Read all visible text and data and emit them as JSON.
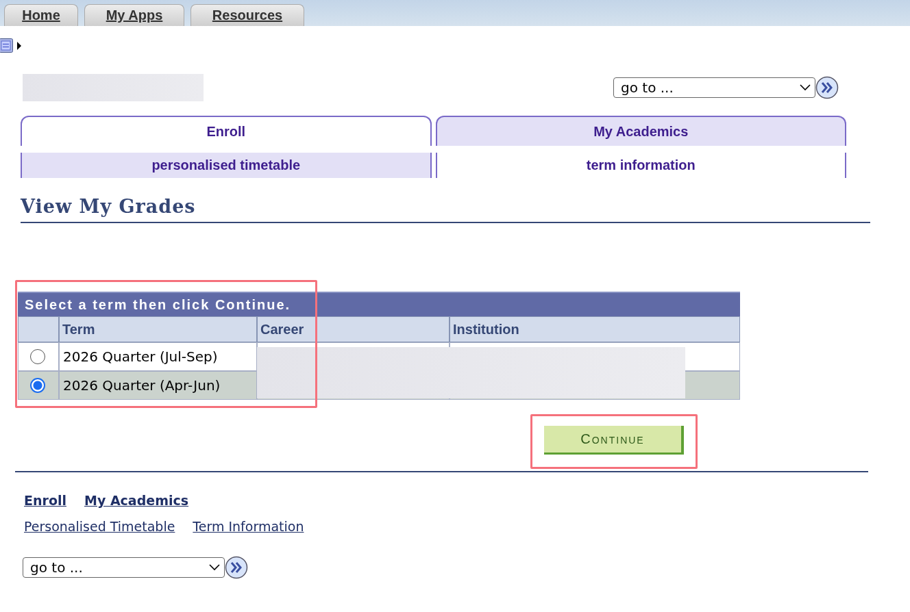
{
  "top_tabs": [
    {
      "label": "Home"
    },
    {
      "label": "My Apps"
    },
    {
      "label": "Resources"
    }
  ],
  "goto_top": {
    "value": "go to ..."
  },
  "tabs": [
    {
      "label": "Enroll",
      "selected": true
    },
    {
      "label": "My Academics",
      "selected": false
    }
  ],
  "subtabs": [
    {
      "label": "personalised timetable",
      "selected": false
    },
    {
      "label": "term information",
      "selected": true
    }
  ],
  "page_title": "View My Grades",
  "table": {
    "caption": "Select a term then click Continue.",
    "columns": [
      "Term",
      "Career",
      "Institution"
    ],
    "rows": [
      {
        "term": "2026 Quarter (Jul-Sep)",
        "selected": false
      },
      {
        "term": "2026 Quarter (Apr-Jun)",
        "selected": true
      }
    ]
  },
  "continue_button": "Continue",
  "footer_links": [
    "Enroll",
    "My Academics"
  ],
  "footer_sublinks": [
    "Personalised Timetable",
    "Term Information"
  ],
  "goto_bottom": {
    "value": "go to ..."
  }
}
